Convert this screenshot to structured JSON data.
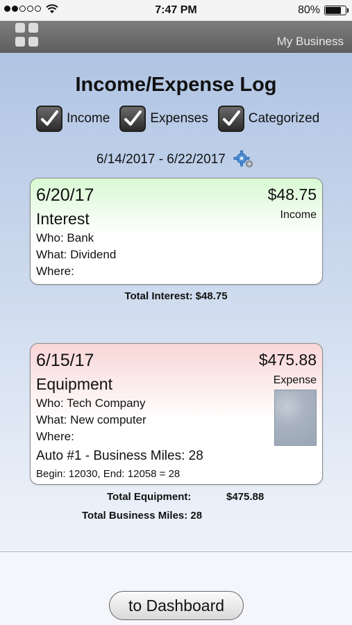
{
  "status": {
    "time": "7:47 PM",
    "battery": "80%"
  },
  "nav": {
    "title": "My Business"
  },
  "page": {
    "title": "Income/Expense Log",
    "filters": [
      {
        "label": "Income",
        "checked": true
      },
      {
        "label": "Expenses",
        "checked": true
      },
      {
        "label": "Categorized",
        "checked": true
      }
    ],
    "date_range": "6/14/2017 - 6/22/2017"
  },
  "entries": [
    {
      "date": "6/20/17",
      "amount": "$48.75",
      "type": "Income",
      "category": "Interest",
      "who": "Who: Bank",
      "what": "What: Dividend",
      "where": "Where:",
      "total_label": "Total Interest: $48.75"
    },
    {
      "date": "6/15/17",
      "amount": "$475.88",
      "type": "Expense",
      "category": "Equipment",
      "who": "Who: Tech Company",
      "what": "What: New computer",
      "where": "Where:",
      "auto": "Auto #1 - Business Miles: 28",
      "odometer": "Begin: 12030, End: 12058 = 28",
      "total_label": "Total Equipment:",
      "total_value": "$475.88",
      "miles_total": "Total Business Miles: 28"
    }
  ],
  "footer": {
    "dashboard_button": "to Dashboard"
  },
  "colors": {
    "income_header": "#d8f8d2",
    "expense_header": "#f9d6d6"
  }
}
